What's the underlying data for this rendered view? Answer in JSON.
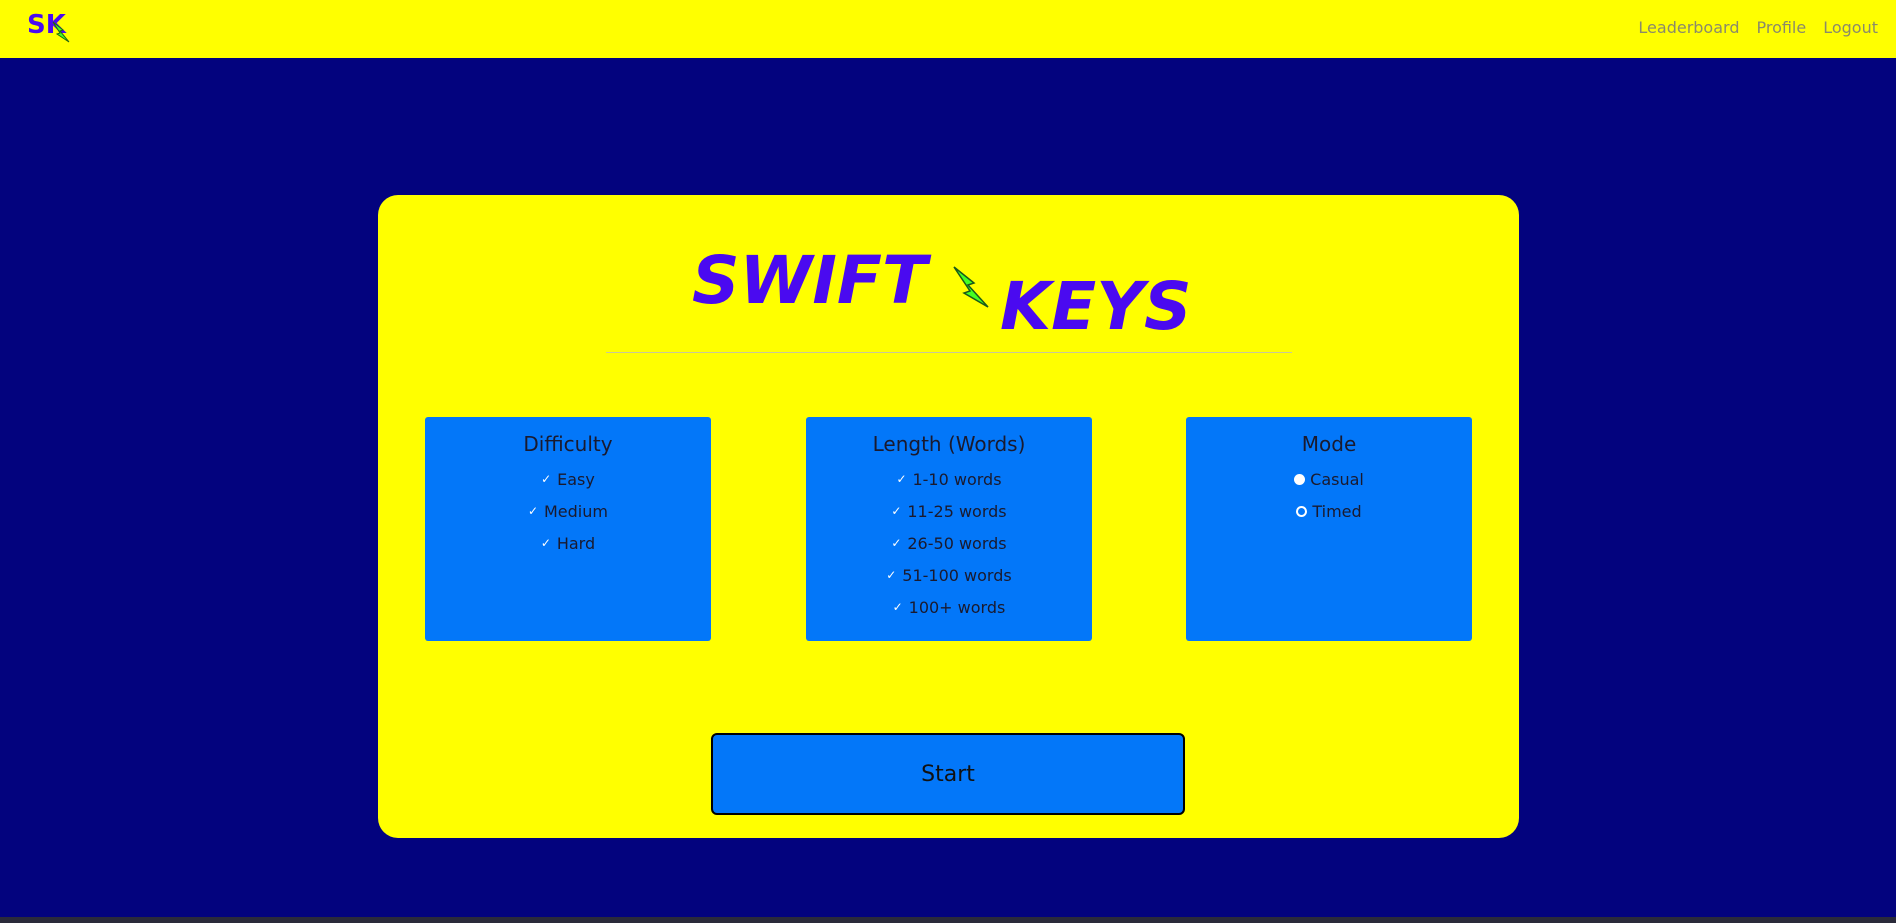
{
  "nav": {
    "logo_text": "SK",
    "links": [
      "Leaderboard",
      "Profile",
      "Logout"
    ]
  },
  "title": {
    "word1": "SWIFT",
    "word2": "KEYS"
  },
  "difficulty": {
    "title": "Difficulty",
    "options": [
      "Easy",
      "Medium",
      "Hard"
    ]
  },
  "length": {
    "title": "Length (Words)",
    "options": [
      "1-10 words",
      "11-25 words",
      "26-50 words",
      "51-100 words",
      "100+ words"
    ]
  },
  "mode": {
    "title": "Mode",
    "options": [
      "Casual",
      "Timed"
    ]
  },
  "start_label": "Start",
  "colors": {
    "background": "#03037e",
    "accent_yellow": "#ffff00",
    "box_blue": "#0377f9",
    "logo_purple": "#4a0af0",
    "bolt_green": "#44ff22"
  }
}
